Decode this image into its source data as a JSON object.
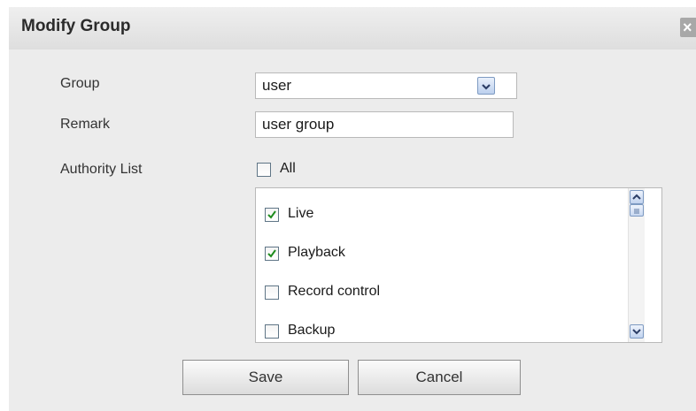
{
  "dialog": {
    "title": "Modify Group",
    "close_icon": "close-icon",
    "colors": {
      "background": "#ececec",
      "titlebar": "#e4e4e4",
      "check": "#1e8c1e"
    }
  },
  "form": {
    "group_label": "Group",
    "group_value": "user",
    "remark_label": "Remark",
    "remark_value": "user group",
    "authority_label": "Authority List",
    "all_label": "All",
    "all_checked": false
  },
  "authority_items": [
    {
      "label": "Live",
      "checked": true
    },
    {
      "label": "Playback",
      "checked": true
    },
    {
      "label": "Record control",
      "checked": false
    },
    {
      "label": "Backup",
      "checked": false
    }
  ],
  "buttons": {
    "save_label": "Save",
    "cancel_label": "Cancel"
  }
}
